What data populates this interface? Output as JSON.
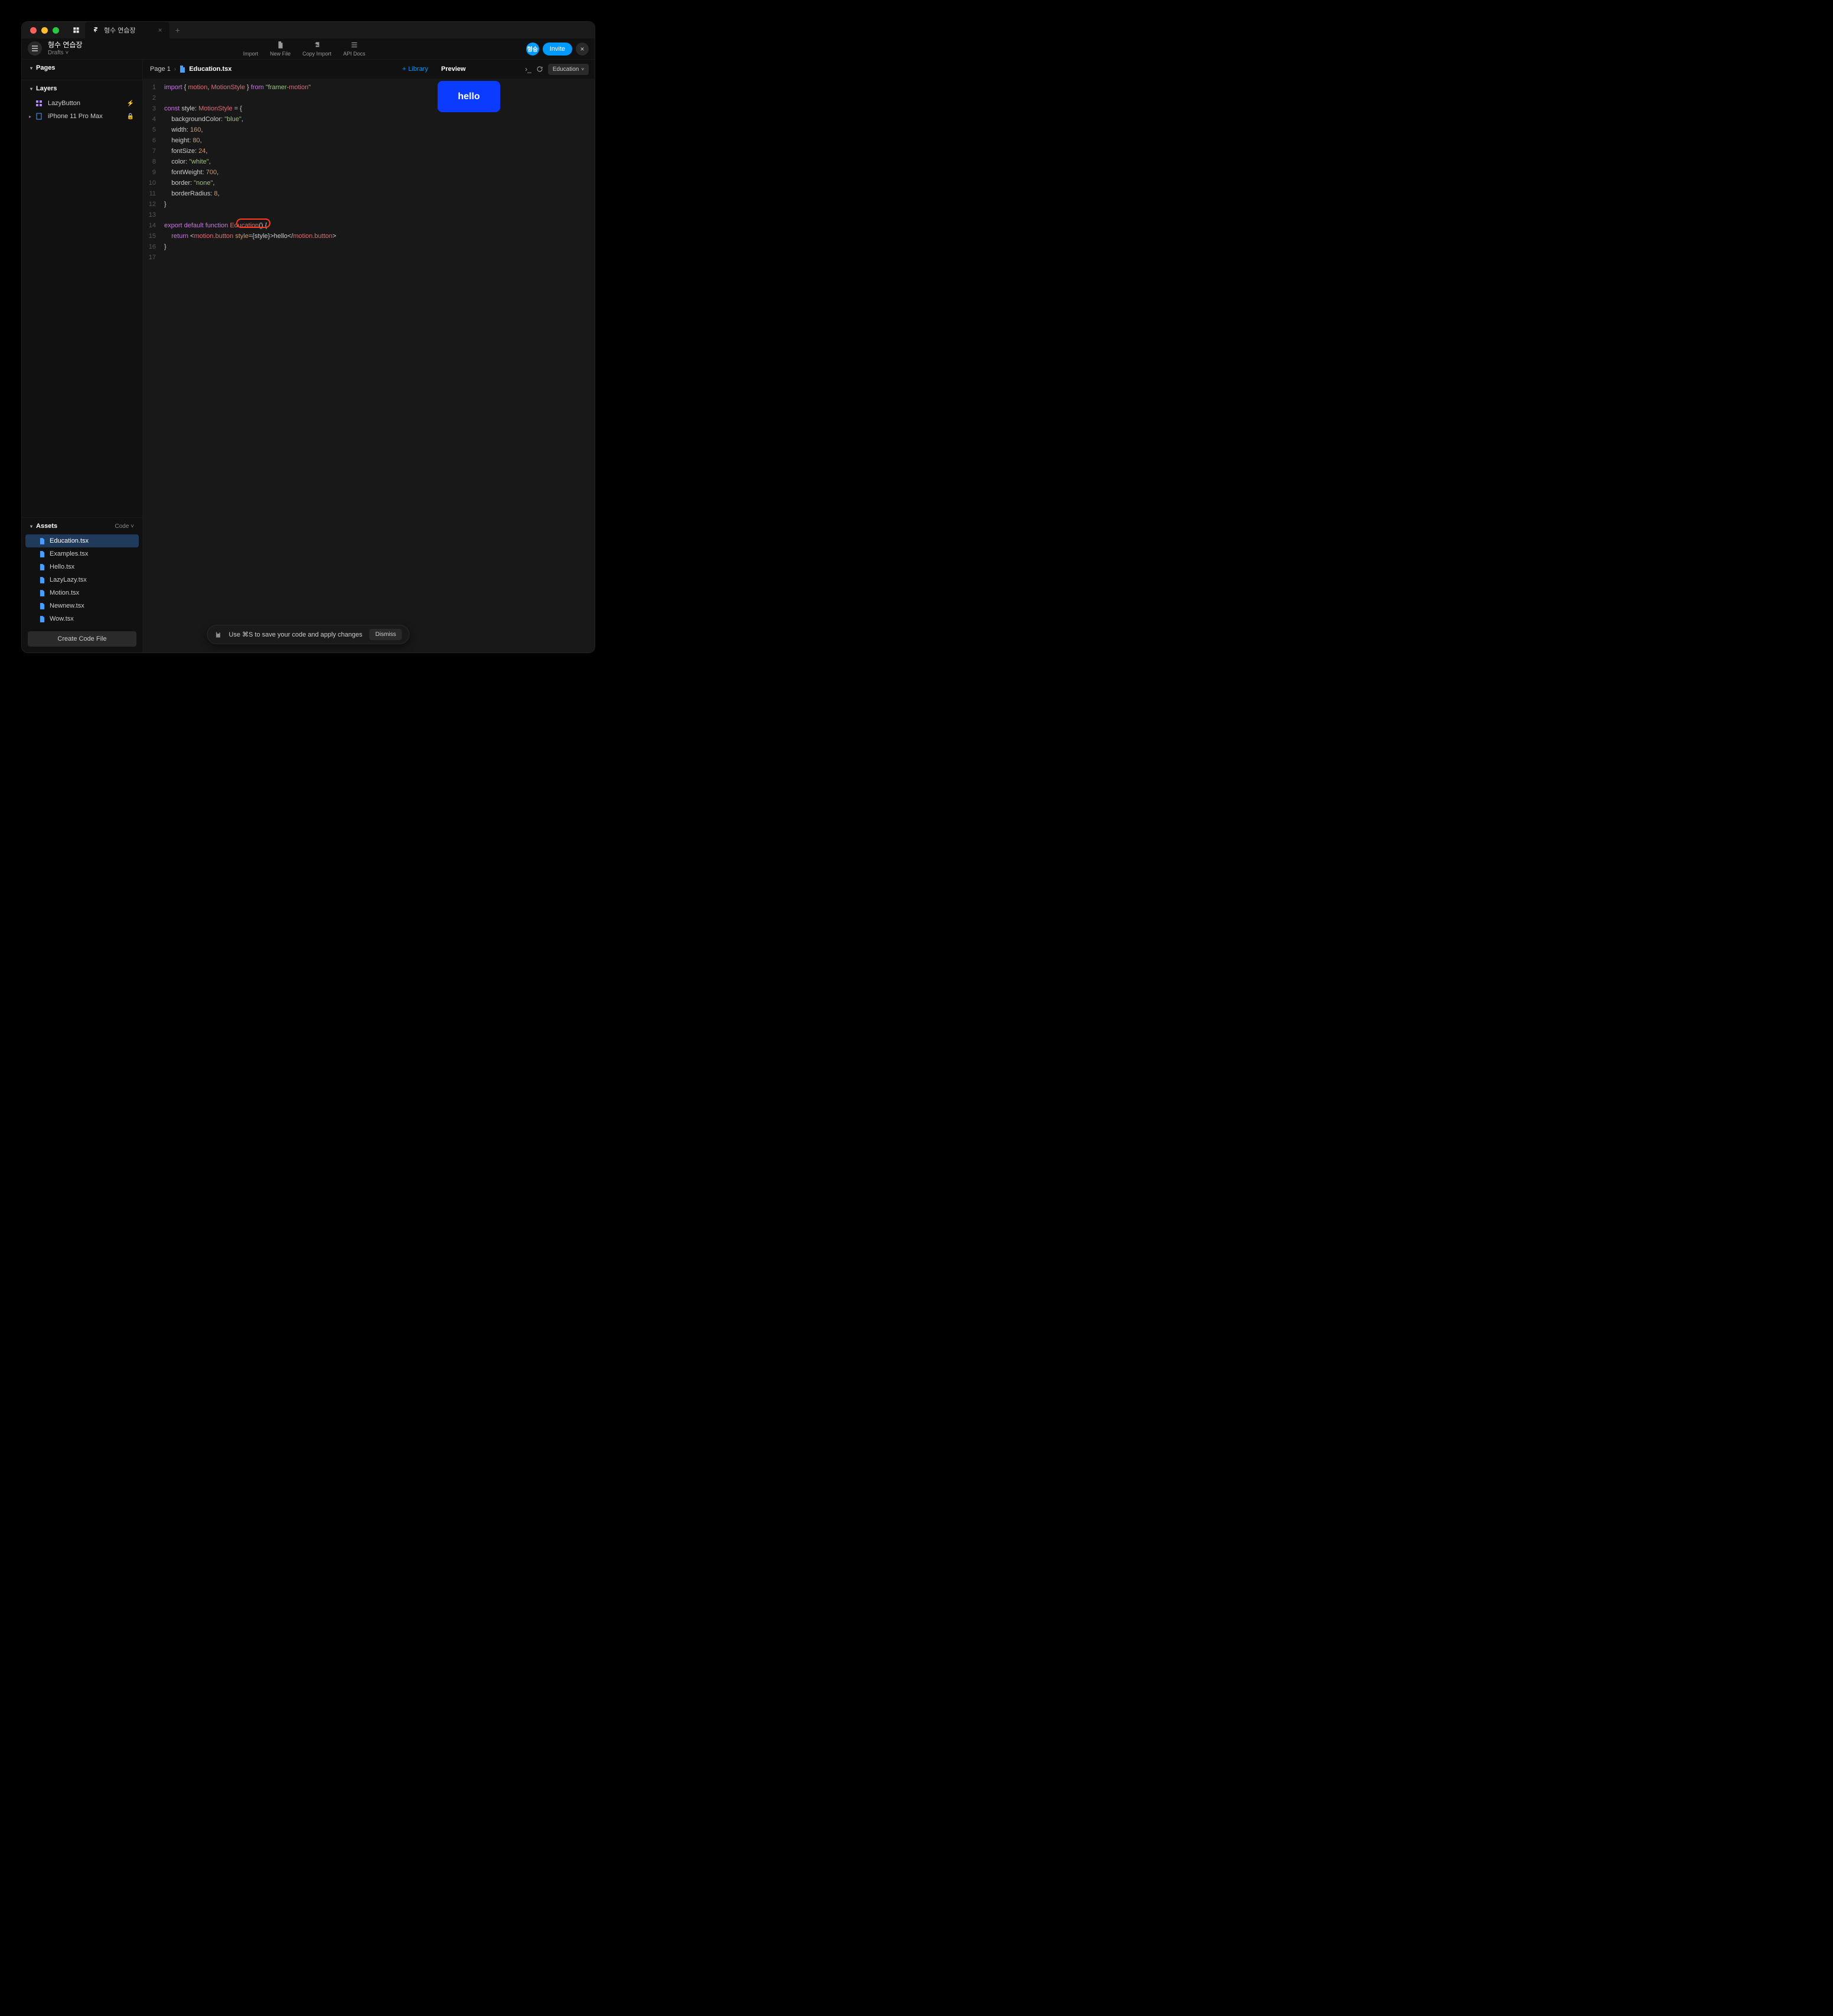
{
  "titlebar": {
    "tab_title": "형수 연습장"
  },
  "project": {
    "title": "형수 연습장",
    "subtitle": "Drafts"
  },
  "toolbar": {
    "actions": [
      {
        "label": "Import"
      },
      {
        "label": "New File"
      },
      {
        "label": "Copy Import"
      },
      {
        "label": "API Docs"
      }
    ],
    "avatar_label": "형승",
    "invite_label": "Invite"
  },
  "sidebar": {
    "pages_label": "Pages",
    "layers_label": "Layers",
    "layers": [
      {
        "name": "LazyButton",
        "icon": "component",
        "status": "⚡"
      },
      {
        "name": "iPhone 11 Pro Max",
        "icon": "frame",
        "status": "🔒"
      }
    ],
    "assets_label": "Assets",
    "code_label": "Code",
    "assets": [
      {
        "name": "Education.tsx",
        "selected": true
      },
      {
        "name": "Examples.tsx",
        "selected": false
      },
      {
        "name": "Hello.tsx",
        "selected": false
      },
      {
        "name": "LazyLazy.tsx",
        "selected": false
      },
      {
        "name": "Motion.tsx",
        "selected": false
      },
      {
        "name": "Newnew.tsx",
        "selected": false
      },
      {
        "name": "Wow.tsx",
        "selected": false
      }
    ],
    "create_label": "Create Code File"
  },
  "breadcrumb": {
    "page": "Page 1",
    "file": "Education.tsx",
    "library_label": "Library"
  },
  "preview": {
    "label": "Preview",
    "select_label": "Education",
    "button_text": "hello"
  },
  "banner": {
    "text": "Use ⌘S to save your code and apply changes",
    "dismiss": "Dismiss"
  },
  "code": {
    "lines": [
      "import { motion, MotionStyle } from \"framer-motion\"",
      "",
      "const style: MotionStyle = {",
      "    backgroundColor: \"blue\",",
      "    width: 160,",
      "    height: 80,",
      "    fontSize: 24,",
      "    color: \"white\",",
      "    fontWeight: 700,",
      "    border: \"none\",",
      "    borderRadius: 8,",
      "}",
      "",
      "export default function Education() {",
      "    return <motion.button style={style}>hello</motion.button>",
      "}",
      ""
    ]
  }
}
